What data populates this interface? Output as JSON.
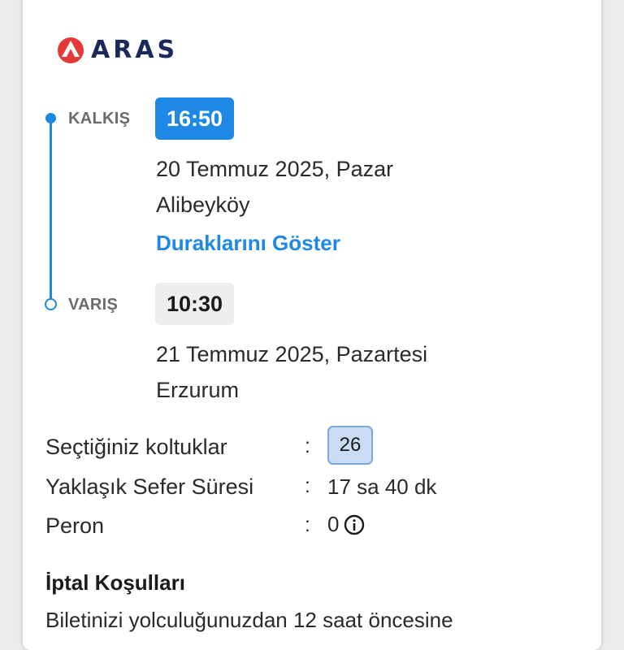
{
  "brand": {
    "name": "ARAS",
    "logo_color": "#e53935",
    "text_color": "#1c2a5a"
  },
  "departure": {
    "label": "KALKIŞ",
    "time": "16:50",
    "date": "20 Temmuz 2025, Pazar",
    "location": "Alibeyköy",
    "show_stops_label": "Duraklarını Göster"
  },
  "arrival": {
    "label": "VARIŞ",
    "time": "10:30",
    "date": "21 Temmuz 2025, Pazartesi",
    "location": "Erzurum"
  },
  "details": {
    "colon": ":",
    "seats_label": "Seçtiğiniz koltuklar",
    "seat_number": "26",
    "duration_label": "Yaklaşık Sefer Süresi",
    "duration_value": "17 sa 40 dk",
    "platform_label": "Peron",
    "platform_value": "0",
    "info_icon": "info-icon"
  },
  "cancellation": {
    "title": "İptal Koşulları",
    "text": "Biletinizi yolculuğunuzdan 12 saat öncesine"
  },
  "colors": {
    "accent": "#1e88e5",
    "arrival_badge_bg": "#eeeeee",
    "seat_bg": "#c9dcf3"
  }
}
